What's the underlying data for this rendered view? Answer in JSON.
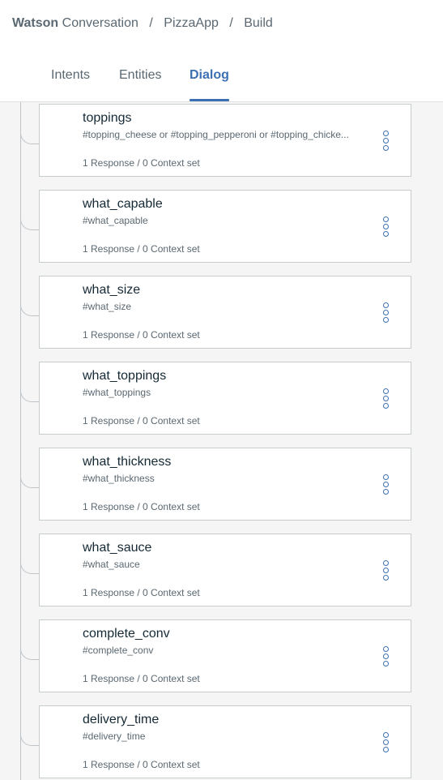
{
  "breadcrumb": {
    "brand_bold": "Watson",
    "brand_rest": " Conversation",
    "separator": "/",
    "workspace": "PizzaApp",
    "page": "Build"
  },
  "tabs": [
    {
      "label": "Intents",
      "active": false
    },
    {
      "label": "Entities",
      "active": false
    },
    {
      "label": "Dialog",
      "active": true
    }
  ],
  "nodes": [
    {
      "title": "toppings",
      "condition": "#topping_cheese or #topping_pepperoni or #topping_chicke...",
      "meta": "1 Response / 0 Context set"
    },
    {
      "title": "what_capable",
      "condition": "#what_capable",
      "meta": "1 Response / 0 Context set"
    },
    {
      "title": "what_size",
      "condition": "#what_size",
      "meta": "1 Response / 0 Context set"
    },
    {
      "title": "what_toppings",
      "condition": "#what_toppings",
      "meta": "1 Response / 0 Context set"
    },
    {
      "title": "what_thickness",
      "condition": "#what_thickness",
      "meta": "1 Response / 0 Context set"
    },
    {
      "title": "what_sauce",
      "condition": "#what_sauce",
      "meta": "1 Response / 0 Context set"
    },
    {
      "title": "complete_conv",
      "condition": "#complete_conv",
      "meta": "1 Response / 0 Context set"
    },
    {
      "title": "delivery_time",
      "condition": "#delivery_time",
      "meta": "1 Response / 0 Context set"
    }
  ],
  "colors": {
    "accent": "#3d70b2",
    "text": "#152935",
    "muted": "#5a6872",
    "canvas": "#f5f5f5",
    "border": "#c7cccf"
  },
  "icons": {
    "node_menu": "overflow-menu-vertical-icon"
  }
}
